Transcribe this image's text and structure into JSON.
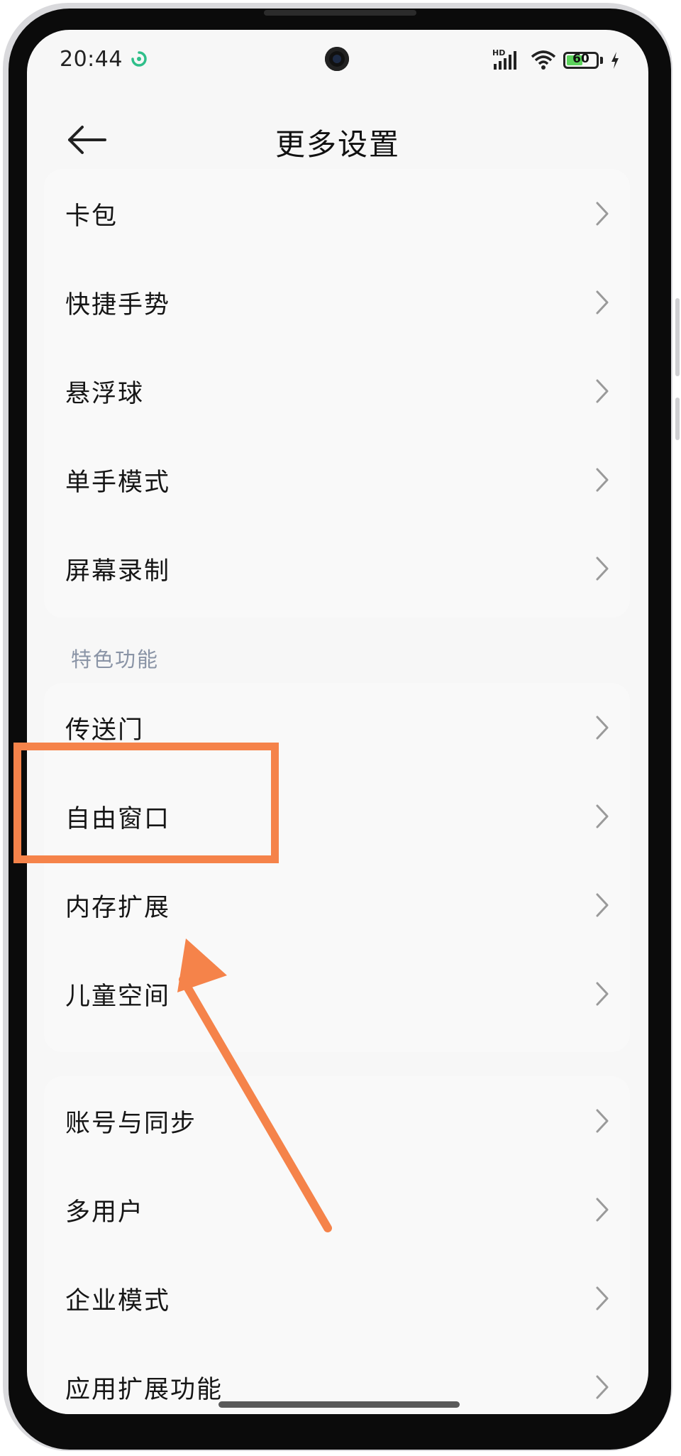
{
  "status_bar": {
    "time": "20:44",
    "network_label": "HD",
    "battery_level": "60",
    "battery_percent": 60
  },
  "header": {
    "title": "更多设置"
  },
  "groups": [
    {
      "items": [
        {
          "label": "卡包"
        },
        {
          "label": "快捷手势"
        },
        {
          "label": "悬浮球"
        },
        {
          "label": "单手模式"
        },
        {
          "label": "屏幕录制"
        }
      ]
    },
    {
      "section_title": "特色功能",
      "items": [
        {
          "label": "传送门"
        },
        {
          "label": "自由窗口"
        },
        {
          "label": "内存扩展"
        },
        {
          "label": "儿童空间"
        }
      ]
    },
    {
      "items": [
        {
          "label": "账号与同步"
        },
        {
          "label": "多用户"
        },
        {
          "label": "企业模式"
        },
        {
          "label": "应用扩展功能"
        }
      ]
    }
  ],
  "icons": {
    "back": "arrow-left-icon",
    "chevron": "chevron-right-icon",
    "app_status": "app-notification-icon",
    "signal": "cellular-signal-icon",
    "wifi": "wifi-icon",
    "battery": "battery-icon",
    "charging": "charging-bolt-icon"
  },
  "colors": {
    "annotation": "#f5834a",
    "battery_fill": "#5cd35c",
    "section_header": "#8a94a6",
    "app_status_icon": "#2fbf8a"
  }
}
